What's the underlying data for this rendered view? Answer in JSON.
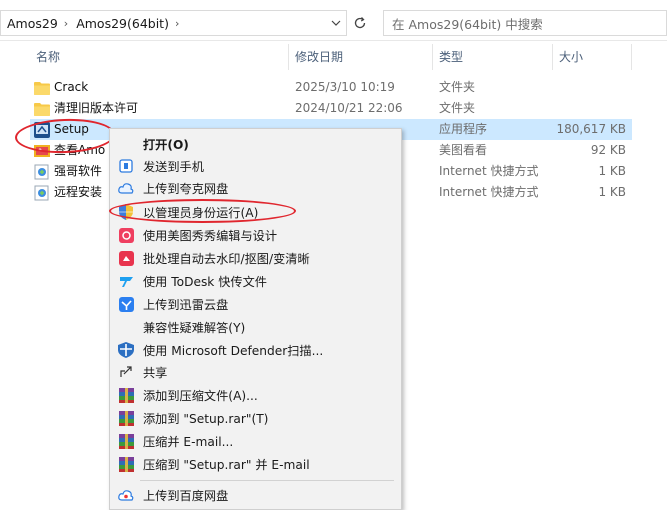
{
  "address": {
    "crumbs": [
      "Amos29",
      "Amos29(64bit)"
    ],
    "search_placeholder": "在 Amos29(64bit) 中搜索"
  },
  "columns": {
    "name": "名称",
    "date": "修改日期",
    "type": "类型",
    "size": "大小"
  },
  "files": [
    {
      "name": "Crack",
      "date": "2025/3/10 10:19",
      "type": "文件夹",
      "size": "",
      "icon": "folder-icon"
    },
    {
      "name": "清理旧版本许可",
      "date": "2024/10/21 22:06",
      "type": "文件夹",
      "size": "",
      "icon": "folder-icon"
    },
    {
      "name": "Setup",
      "date": "",
      "type": "应用程序",
      "size": "180,617 KB",
      "icon": "setup-app-icon"
    },
    {
      "name": "查看Amo",
      "date": "",
      "type": "美图看看",
      "size": "92 KB",
      "icon": "image-file-icon"
    },
    {
      "name": "强哥软件",
      "date": "",
      "type": "Internet 快捷方式",
      "size": "1 KB",
      "icon": "internet-shortcut-icon"
    },
    {
      "name": "远程安装",
      "date": "",
      "type": "Internet 快捷方式",
      "size": "1 KB",
      "icon": "internet-shortcut-icon"
    }
  ],
  "context_menu": {
    "items": [
      {
        "label": "打开(O)",
        "icon": "none"
      },
      {
        "label": "发送到手机",
        "icon": "phone-icon"
      },
      {
        "label": "上传到夸克网盘",
        "icon": "quark-cloud-icon"
      },
      {
        "label": "以管理员身份运行(A)",
        "icon": "uac-shield-icon"
      },
      {
        "label": "使用美图秀秀编辑与设计",
        "icon": "meitu-icon"
      },
      {
        "label": "批处理自动去水印/抠图/变清晰",
        "icon": "batch-edit-icon"
      },
      {
        "label": "使用 ToDesk 快传文件",
        "icon": "todesk-icon"
      },
      {
        "label": "上传到迅雷云盘",
        "icon": "xunlei-icon"
      },
      {
        "label": "兼容性疑难解答(Y)",
        "icon": "none"
      },
      {
        "label": "使用 Microsoft Defender扫描...",
        "icon": "defender-icon"
      },
      {
        "label": "共享",
        "icon": "share-icon"
      },
      {
        "label": "添加到压缩文件(A)...",
        "icon": "winrar-icon"
      },
      {
        "label": "添加到 \"Setup.rar\"(T)",
        "icon": "winrar-icon"
      },
      {
        "label": "压缩并 E-mail...",
        "icon": "winrar-icon"
      },
      {
        "label": "压缩到 \"Setup.rar\" 并 E-mail",
        "icon": "winrar-icon"
      },
      {
        "label": "上传到百度网盘",
        "icon": "baidu-cloud-icon"
      }
    ]
  },
  "colors": {
    "selection": "#cce8ff",
    "annotation": "#e0262e",
    "menu_bg": "#f2f2f2",
    "folder": "#f7c948"
  }
}
